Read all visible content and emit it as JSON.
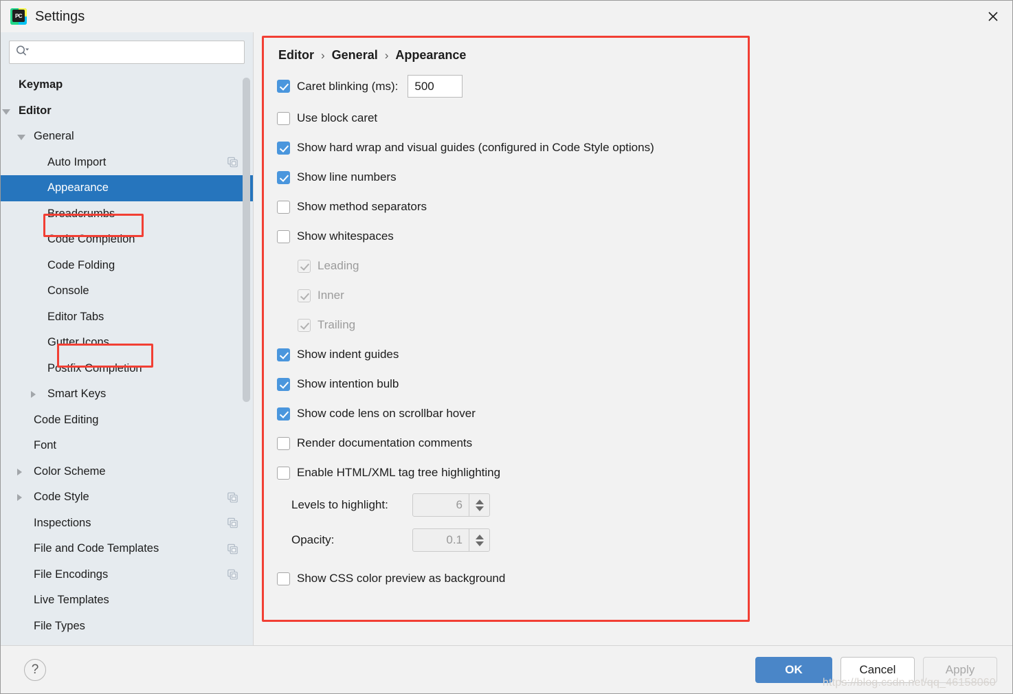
{
  "window": {
    "title": "Settings",
    "logo_text": "PC",
    "close_icon": "close-icon"
  },
  "sidebar": {
    "search": {
      "placeholder": "",
      "icon": "search-icon"
    },
    "items": [
      {
        "label": "Keymap",
        "indent": 0,
        "bold": true,
        "twisty": "none",
        "selected": false,
        "dup": false
      },
      {
        "label": "Editor",
        "indent": 0,
        "bold": true,
        "twisty": "expanded",
        "selected": false,
        "dup": false
      },
      {
        "label": "General",
        "indent": 1,
        "bold": false,
        "twisty": "expanded",
        "selected": false,
        "dup": false
      },
      {
        "label": "Auto Import",
        "indent": 2,
        "bold": false,
        "twisty": "none",
        "selected": false,
        "dup": true
      },
      {
        "label": "Appearance",
        "indent": 2,
        "bold": false,
        "twisty": "none",
        "selected": true,
        "dup": false
      },
      {
        "label": "Breadcrumbs",
        "indent": 2,
        "bold": false,
        "twisty": "none",
        "selected": false,
        "dup": false
      },
      {
        "label": "Code Completion",
        "indent": 2,
        "bold": false,
        "twisty": "none",
        "selected": false,
        "dup": false
      },
      {
        "label": "Code Folding",
        "indent": 2,
        "bold": false,
        "twisty": "none",
        "selected": false,
        "dup": false
      },
      {
        "label": "Console",
        "indent": 2,
        "bold": false,
        "twisty": "none",
        "selected": false,
        "dup": false
      },
      {
        "label": "Editor Tabs",
        "indent": 2,
        "bold": false,
        "twisty": "none",
        "selected": false,
        "dup": false
      },
      {
        "label": "Gutter Icons",
        "indent": 2,
        "bold": false,
        "twisty": "none",
        "selected": false,
        "dup": false
      },
      {
        "label": "Postfix Completion",
        "indent": 2,
        "bold": false,
        "twisty": "none",
        "selected": false,
        "dup": false
      },
      {
        "label": "Smart Keys",
        "indent": 2,
        "bold": false,
        "twisty": "collapsed",
        "selected": false,
        "dup": false
      },
      {
        "label": "Code Editing",
        "indent": 1,
        "bold": false,
        "twisty": "none",
        "selected": false,
        "dup": false
      },
      {
        "label": "Font",
        "indent": 1,
        "bold": false,
        "twisty": "none",
        "selected": false,
        "dup": false
      },
      {
        "label": "Color Scheme",
        "indent": 1,
        "bold": false,
        "twisty": "collapsed",
        "selected": false,
        "dup": false
      },
      {
        "label": "Code Style",
        "indent": 1,
        "bold": false,
        "twisty": "collapsed",
        "selected": false,
        "dup": true
      },
      {
        "label": "Inspections",
        "indent": 1,
        "bold": false,
        "twisty": "none",
        "selected": false,
        "dup": true
      },
      {
        "label": "File and Code Templates",
        "indent": 1,
        "bold": false,
        "twisty": "none",
        "selected": false,
        "dup": true
      },
      {
        "label": "File Encodings",
        "indent": 1,
        "bold": false,
        "twisty": "none",
        "selected": false,
        "dup": true
      },
      {
        "label": "Live Templates",
        "indent": 1,
        "bold": false,
        "twisty": "none",
        "selected": false,
        "dup": false
      },
      {
        "label": "File Types",
        "indent": 1,
        "bold": false,
        "twisty": "none",
        "selected": false,
        "dup": false
      }
    ]
  },
  "main": {
    "breadcrumb": {
      "root": "Editor",
      "middle": "General",
      "leaf": "Appearance",
      "separator": "›"
    },
    "options": [
      {
        "id": "caret-blinking",
        "label": "Caret blinking (ms):",
        "checked": true,
        "enabled": true,
        "indent": 0,
        "field": "500"
      },
      {
        "id": "use-block-caret",
        "label": "Use block caret",
        "checked": false,
        "enabled": true,
        "indent": 0
      },
      {
        "id": "show-hard-wrap",
        "label": "Show hard wrap and visual guides (configured in Code Style options)",
        "checked": true,
        "enabled": true,
        "indent": 0
      },
      {
        "id": "show-line-numbers",
        "label": "Show line numbers",
        "checked": true,
        "enabled": true,
        "indent": 0
      },
      {
        "id": "show-method-separators",
        "label": "Show method separators",
        "checked": false,
        "enabled": true,
        "indent": 0
      },
      {
        "id": "show-whitespaces",
        "label": "Show whitespaces",
        "checked": false,
        "enabled": true,
        "indent": 0
      },
      {
        "id": "whitespace-leading",
        "label": "Leading",
        "checked": true,
        "enabled": false,
        "indent": 1
      },
      {
        "id": "whitespace-inner",
        "label": "Inner",
        "checked": true,
        "enabled": false,
        "indent": 1
      },
      {
        "id": "whitespace-trailing",
        "label": "Trailing",
        "checked": true,
        "enabled": false,
        "indent": 1
      },
      {
        "id": "show-indent-guides",
        "label": "Show indent guides",
        "checked": true,
        "enabled": true,
        "indent": 0
      },
      {
        "id": "show-intention-bulb",
        "label": "Show intention bulb",
        "checked": true,
        "enabled": true,
        "indent": 0
      },
      {
        "id": "show-code-lens",
        "label": "Show code lens on scrollbar hover",
        "checked": true,
        "enabled": true,
        "indent": 0
      },
      {
        "id": "render-doc-comments",
        "label": "Render documentation comments",
        "checked": false,
        "enabled": true,
        "indent": 0
      },
      {
        "id": "enable-tag-tree",
        "label": "Enable HTML/XML tag tree highlighting",
        "checked": false,
        "enabled": true,
        "indent": 0
      }
    ],
    "spinners": [
      {
        "id": "levels-to-highlight",
        "label": "Levels to highlight:",
        "value": "6",
        "enabled": false
      },
      {
        "id": "opacity",
        "label": "Opacity:",
        "value": "0.1",
        "enabled": false
      }
    ],
    "last_option": {
      "id": "show-css-color-preview",
      "label": "Show CSS color preview as background",
      "checked": false,
      "enabled": true
    }
  },
  "footer": {
    "help_label": "?",
    "ok_label": "OK",
    "cancel_label": "Cancel",
    "apply_label": "Apply",
    "watermark": "https://blog.csdn.net/qq_46158060"
  },
  "annotations": {
    "appearance_highlight": "red-box-around-appearance",
    "editor_tabs_highlight": "red-box-around-editor-tabs",
    "panel_highlight": "red-box-around-settings-panel"
  },
  "colors": {
    "selection_blue": "#2675bd",
    "checkbox_blue": "#4a96dd",
    "primary_button": "#4a86c8",
    "annotation_red": "#f23f34",
    "sidebar_bg": "#e6ebef",
    "panel_bg": "#f2f2f2"
  }
}
